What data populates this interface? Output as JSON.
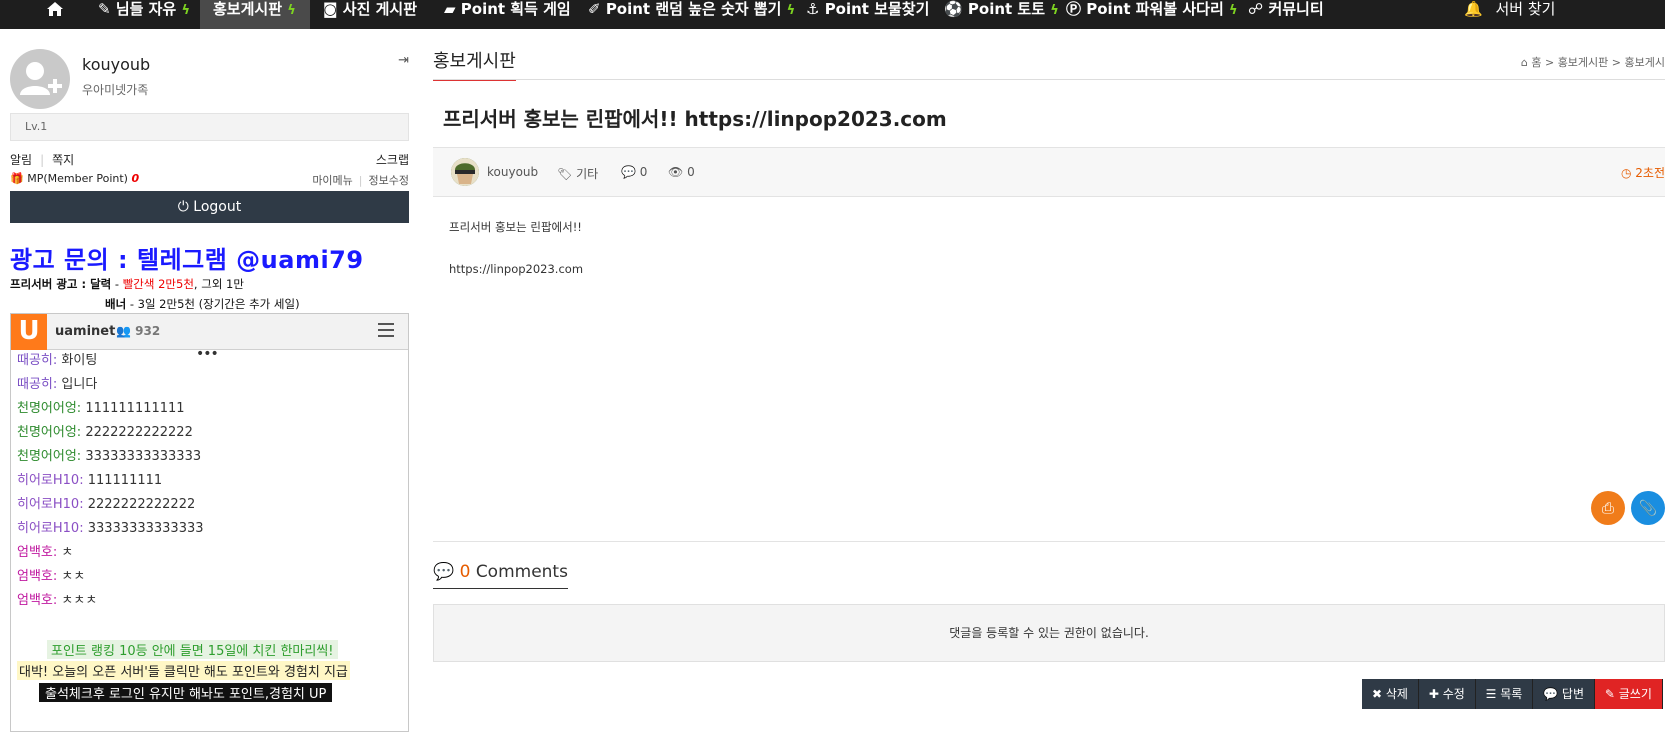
{
  "nav": {
    "items": [
      {
        "icon": "home-icon",
        "label": ""
      },
      {
        "icon": "pencil-icon",
        "label": "님들 자유"
      },
      {
        "icon": "",
        "label": "홍보게시판"
      },
      {
        "icon": "camera-icon",
        "label": "사진 게시판"
      },
      {
        "icon": "gamepad-icon",
        "label": "Point 획득 게임"
      },
      {
        "icon": "wand-icon",
        "label": "Point 랜덤 높은 숫자 뽑기"
      },
      {
        "icon": "anchor-icon",
        "label": "Point 보물찾기"
      },
      {
        "icon": "soccer-icon",
        "label": "Point 토토"
      },
      {
        "icon": "p-icon",
        "label": "Point 파워볼 사다리"
      },
      {
        "icon": "handshake-icon",
        "label": "커뮤니티"
      }
    ],
    "right_label": "서버 찾기"
  },
  "sidebar": {
    "username": "kouyoub",
    "group": "우아미넷가족",
    "level": "Lv.1",
    "alarm": "알림",
    "memo": "쪽지",
    "scrap": "스크랩",
    "mp_label": "MP(Member Point)",
    "mp_value": "0",
    "my_menu": "마이메뉴",
    "edit_info": "정보수정",
    "logout": "Logout"
  },
  "ad": {
    "title": "광고 문의 :  텔레그램 @uami79",
    "line1_label": "프리서버 광고 : 달력",
    "line1_dash": " - ",
    "line1_red": "빨간색 2만5천",
    "line1_rest": ", 그외 1만",
    "line2_label": "배너",
    "line2_rest": " - 3일 2만5천 (장기간은 추가 세일)"
  },
  "chat": {
    "name": "uaminet",
    "count": "932",
    "messages": [
      {
        "nick": "때공히:",
        "text": "화이팅",
        "color": "#7a4fc4"
      },
      {
        "nick": "때공히:",
        "text": "입니다",
        "color": "#7a4fc4"
      },
      {
        "nick": "천명어어엉:",
        "text": "111111111111",
        "color": "#2e8b2e"
      },
      {
        "nick": "천명어어엉:",
        "text": "2222222222222",
        "color": "#2e8b2e"
      },
      {
        "nick": "천명어어엉:",
        "text": "33333333333333",
        "color": "#2e8b2e"
      },
      {
        "nick": "히어로H10:",
        "text": "111111111",
        "color": "#8a4fc4"
      },
      {
        "nick": "히어로H10:",
        "text": "2222222222222",
        "color": "#8a4fc4"
      },
      {
        "nick": "히어로H10:",
        "text": "33333333333333",
        "color": "#8a4fc4"
      },
      {
        "nick": "엄백호:",
        "text": "ㅊ",
        "color": "#c01aa0"
      },
      {
        "nick": "엄백호:",
        "text": "ㅊㅊ",
        "color": "#c01aa0"
      },
      {
        "nick": "엄백호:",
        "text": "ㅊㅊㅊ",
        "color": "#c01aa0"
      }
    ],
    "notice1": "포인트 랭킹 10등 안에 들면 15일에 치킨 한마리씩!",
    "notice2": "대박! 오늘의 오픈 서버'들 클릭만 해도 포인트와 경험치 지급",
    "notice3": "출석체크후 로그인 유지만 해놔도 포인트,경험치 UP"
  },
  "main": {
    "board_title": "홍보게시판",
    "crumb_home": "홈",
    "crumb_1": "홍보게시판",
    "crumb_2": "홍보게시",
    "post_title": "프리서버 홍보는 린팝에서!! https://linpop2023.com",
    "author": "kouyoub",
    "category": "기타",
    "comments_count": "0",
    "views": "0",
    "time": "2초전",
    "body_1": "프리서버 홍보는 린팝에서!!",
    "body_2": "https://linpop2023.com",
    "comments_label": "Comments",
    "comments_num": "0",
    "no_permission": "댓글을 등록할 수 있는 권한이 없습니다.",
    "actions": {
      "delete": "삭제",
      "edit": "수정",
      "list": "목록",
      "reply": "답변",
      "write": "글쓰기"
    }
  }
}
